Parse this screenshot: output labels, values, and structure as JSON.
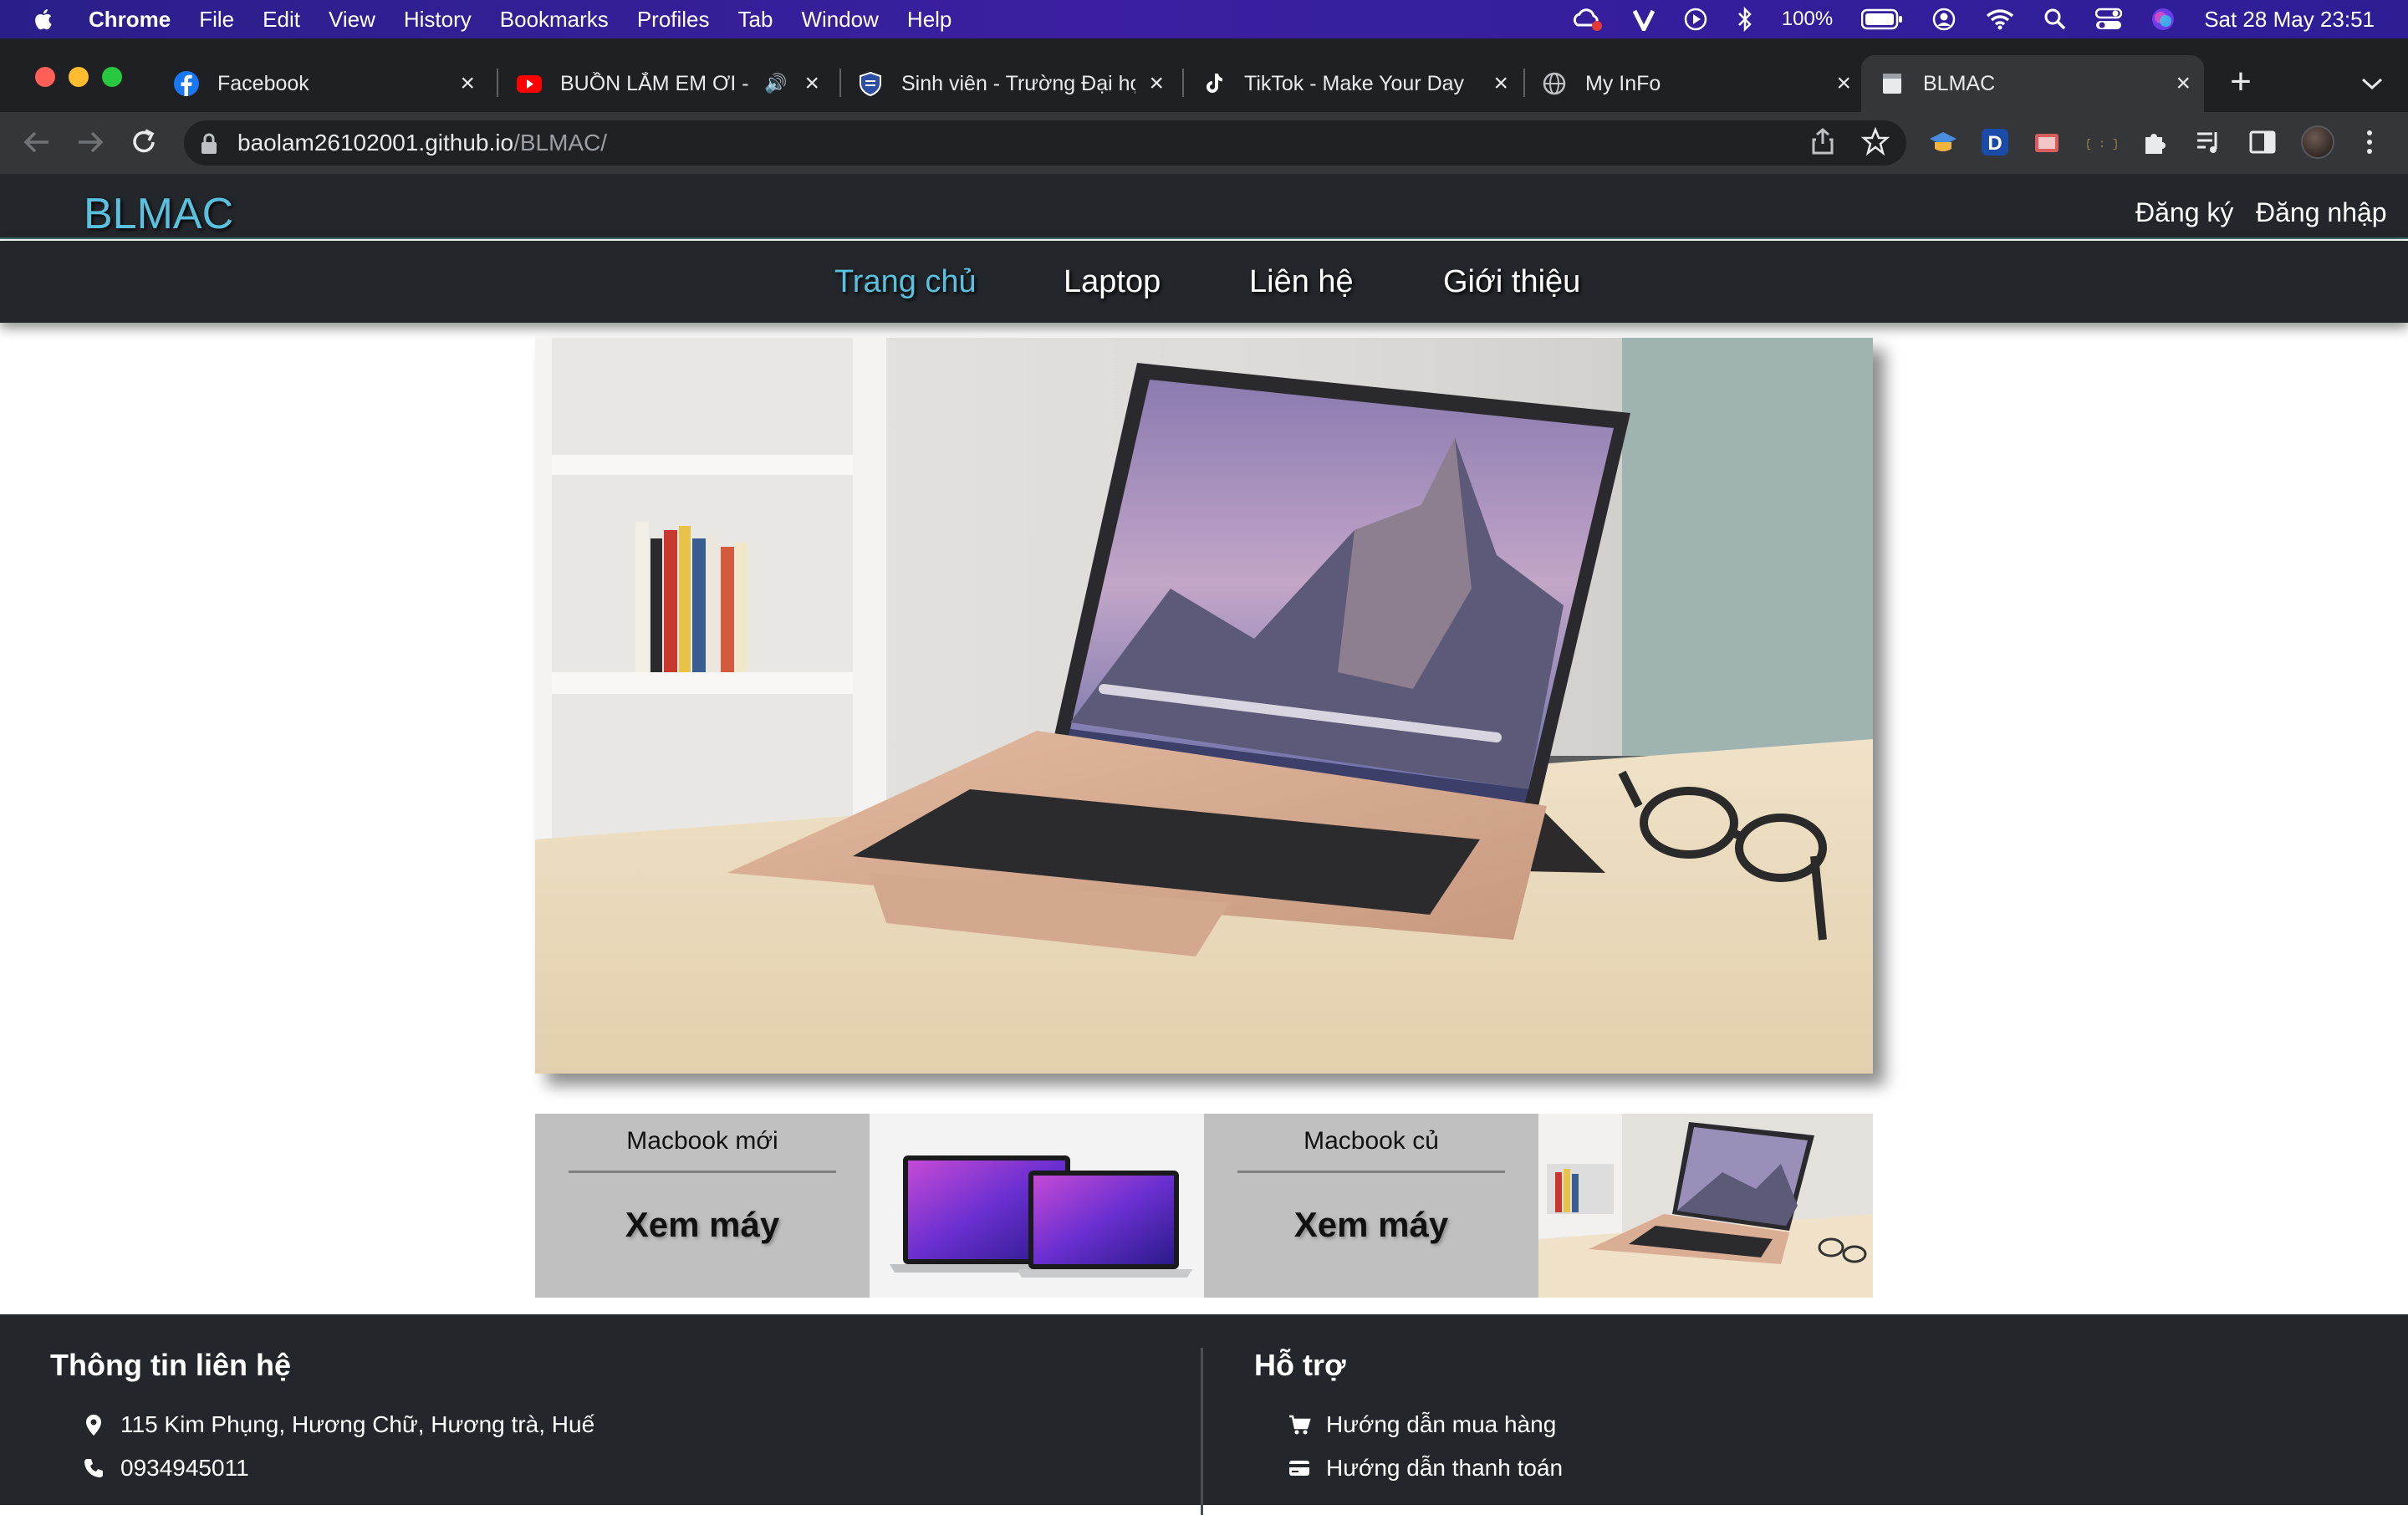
{
  "menubar": {
    "app": "Chrome",
    "items": [
      "File",
      "Edit",
      "View",
      "History",
      "Bookmarks",
      "Profiles",
      "Tab",
      "Window",
      "Help"
    ],
    "battery": "100%",
    "datetime": "Sat 28 May  23:51"
  },
  "tabs": [
    {
      "title": "Facebook",
      "icon": "facebook-icon"
    },
    {
      "title": "BUỒN LẮM EM ƠI - T",
      "icon": "youtube-icon"
    },
    {
      "title": "Sinh viên - Trường Đại họ",
      "icon": "university-shield-icon"
    },
    {
      "title": "TikTok - Make Your Day",
      "icon": "tiktok-icon"
    },
    {
      "title": "My InFo",
      "icon": "globe-icon"
    },
    {
      "title": "BLMAC",
      "icon": "page-icon"
    }
  ],
  "address": {
    "host": "baolam26102001.github.io",
    "path": "/BLMAC/"
  },
  "site": {
    "logo": "BLMAC",
    "register": "Đăng ký",
    "login": "Đăng nhập",
    "nav": [
      "Trang chủ",
      "Laptop",
      "Liên hệ",
      "Giới thiệu"
    ],
    "active_nav": "Trang chủ",
    "accent_color": "#5bc0de",
    "header_bg": "#23272b"
  },
  "products": [
    {
      "title": "Macbook mới",
      "cta": "Xem máy"
    },
    {
      "title": "Macbook củ",
      "cta": "Xem máy"
    }
  ],
  "footer": {
    "contact_title": "Thông tin liên hệ",
    "address": "115 Kim Phụng, Hương Chữ, Hương trà, Huế",
    "phone": "0934945011",
    "support_title": "Hỗ trợ",
    "support_items": [
      "Hướng dẫn mua hàng",
      "Hướng dẫn thanh toán"
    ]
  }
}
